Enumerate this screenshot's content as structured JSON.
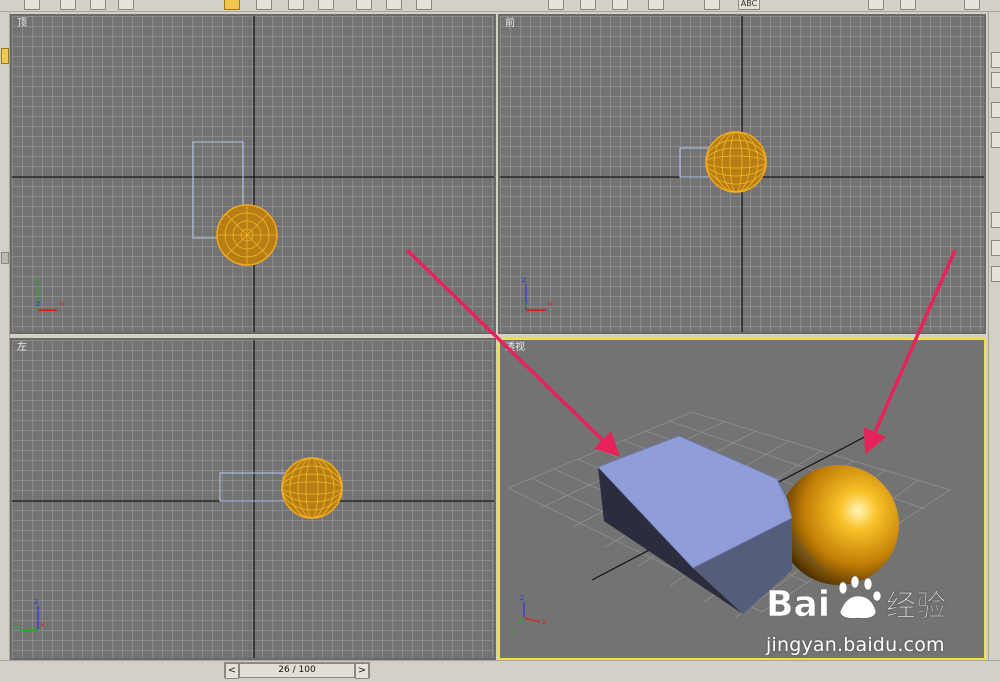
{
  "toolbar": {
    "tools": [
      {
        "icon": "undo-icon"
      },
      {
        "icon": "link-icon"
      },
      {
        "icon": "unlink-icon"
      },
      {
        "icon": "bind-warp-icon"
      },
      {
        "icon": "select-object-icon",
        "active": true
      },
      {
        "icon": "select-by-name-icon"
      },
      {
        "icon": "rect-region-icon"
      },
      {
        "icon": "window-crossing-icon"
      },
      {
        "icon": "move-icon"
      },
      {
        "icon": "rotate-icon"
      },
      {
        "icon": "scale-icon"
      },
      {
        "icon": "mirror-icon"
      },
      {
        "icon": "align-icon"
      },
      {
        "icon": "spinner-snap-icon"
      },
      {
        "icon": "named-selection-icon"
      },
      {
        "icon": "render-icon"
      }
    ],
    "named_selection_label": "ABC"
  },
  "viewports": {
    "top": {
      "label": "顶"
    },
    "front": {
      "label": "前"
    },
    "left": {
      "label": "左"
    },
    "perspective": {
      "label": "透视",
      "active": true
    }
  },
  "axis_gizmo": {
    "x": "x",
    "y": "y",
    "z": "z"
  },
  "colors": {
    "viewport_bg": "#737373",
    "grid_line": "#8b8b8b",
    "sphere_wire": "#f2a81d",
    "box_wire": "#b9c7f0",
    "box_face_top": "#8f9ed6",
    "box_face_side": "#2c2e40",
    "active_border": "#f2e04a",
    "arrow": "#e8225a"
  },
  "timeline": {
    "frame_label": "26 / 100",
    "current_frame": 26,
    "total_frames": 100,
    "prev_label": "<",
    "next_label": ">"
  },
  "watermark": {
    "brand": "Bai经验",
    "url": "jingyan.baidu.com"
  }
}
